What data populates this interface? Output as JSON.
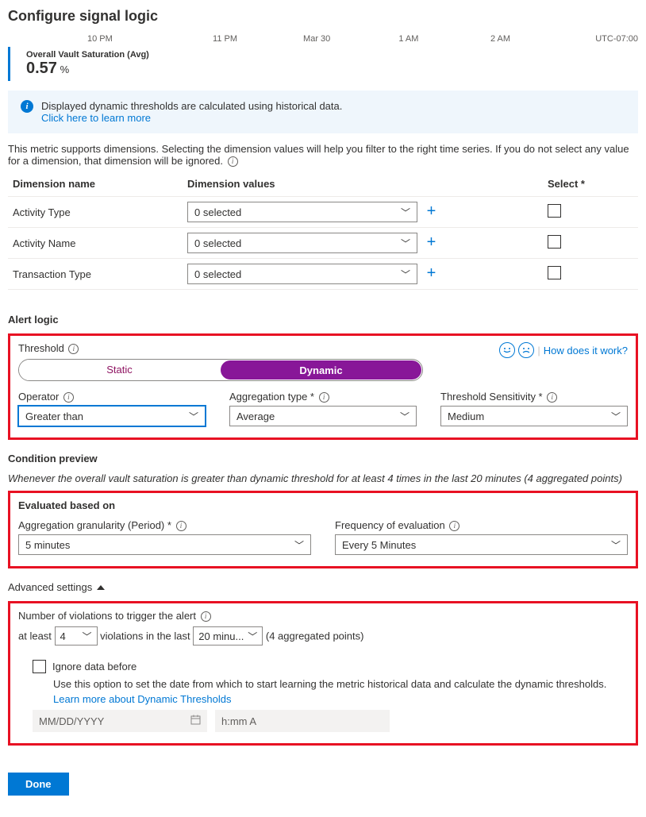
{
  "title": "Configure signal logic",
  "timeAxis": [
    "10 PM",
    "11 PM",
    "Mar 30",
    "1 AM",
    "2 AM",
    "UTC-07:00"
  ],
  "metric": {
    "label": "Overall Vault Saturation (Avg)",
    "value": "0.57",
    "unit": "%"
  },
  "banner": {
    "text": "Displayed dynamic thresholds are calculated using historical data.",
    "link": "Click here to learn more"
  },
  "dimensions": {
    "intro": "This metric supports dimensions. Selecting the dimension values will help you filter to the right time series. If you do not select any value for a dimension, that dimension will be ignored.",
    "headers": {
      "name": "Dimension name",
      "values": "Dimension values",
      "select": "Select *"
    },
    "rows": [
      {
        "name": "Activity Type",
        "value": "0 selected"
      },
      {
        "name": "Activity Name",
        "value": "0 selected"
      },
      {
        "name": "Transaction Type",
        "value": "0 selected"
      }
    ]
  },
  "alertLogic": {
    "heading": "Alert logic",
    "thresholdLabel": "Threshold",
    "staticLabel": "Static",
    "dynamicLabel": "Dynamic",
    "feedbackLink": "How does it work?",
    "operator": {
      "label": "Operator",
      "value": "Greater than"
    },
    "aggType": {
      "label": "Aggregation type *",
      "value": "Average"
    },
    "sensitivity": {
      "label": "Threshold Sensitivity *",
      "value": "Medium"
    }
  },
  "preview": {
    "heading": "Condition preview",
    "text": "Whenever the overall vault saturation is greater than dynamic threshold for at least 4 times in the last 20 minutes (4 aggregated points)"
  },
  "evaluated": {
    "heading": "Evaluated based on",
    "granularity": {
      "label": "Aggregation granularity (Period) *",
      "value": "5 minutes"
    },
    "frequency": {
      "label": "Frequency of evaluation",
      "value": "Every 5 Minutes"
    }
  },
  "advanced": {
    "toggle": "Advanced settings",
    "violationsLabel": "Number of violations to trigger the alert",
    "line": {
      "prefix": "at least",
      "count": "4",
      "mid": "violations in the last",
      "window": "20 minu...",
      "suffix": "(4 aggregated points)"
    },
    "ignore": {
      "label": "Ignore data before",
      "desc": "Use this option to set the date from which to start learning the metric historical data and calculate the dynamic thresholds.",
      "learn": "Learn more about Dynamic Thresholds",
      "datePh": "MM/DD/YYYY",
      "timePh": "h:mm A"
    }
  },
  "doneLabel": "Done"
}
